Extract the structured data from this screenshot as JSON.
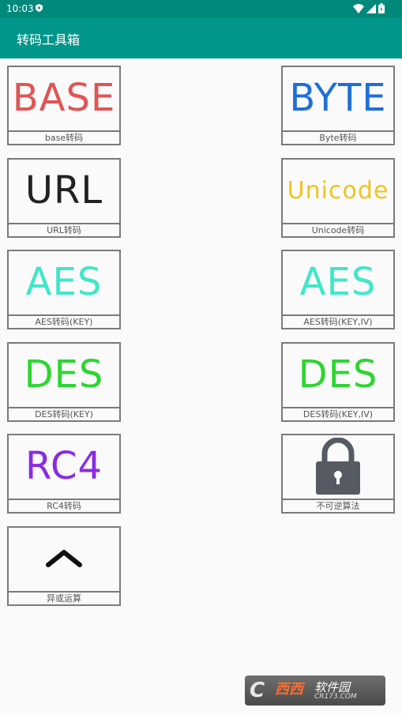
{
  "status": {
    "time": "10:03"
  },
  "app": {
    "title": "转码工具箱"
  },
  "tiles": [
    {
      "art": "BASE",
      "caption": "base转码",
      "color": "#e05555"
    },
    {
      "art": "BYTE",
      "caption": "Byte转码",
      "color": "#1e6fd9"
    },
    {
      "art": "URL",
      "caption": "URL转码",
      "color": "#222222"
    },
    {
      "art": "Unicode",
      "caption": "Unicode转码",
      "color": "#f2c41d"
    },
    {
      "art": "AES",
      "caption": "AES转码(KEY)",
      "color": "#3ee8c8"
    },
    {
      "art": "AES",
      "caption": "AES转码(KEY,IV)",
      "color": "#3ee8c8"
    },
    {
      "art": "DES",
      "caption": "DES转码(KEY)",
      "color": "#2bd630"
    },
    {
      "art": "DES",
      "caption": "DES转码(KEY,IV)",
      "color": "#2bd630"
    },
    {
      "art": "RC4",
      "caption": "RC4转码",
      "color": "#8a2be2"
    },
    {
      "art": "lock-icon",
      "caption": "不可逆算法",
      "color": "#555a63"
    },
    {
      "art": "caret-icon",
      "caption": "异或运算",
      "color": "#111111"
    }
  ],
  "watermark": {
    "brand": "西西",
    "site": "软件园",
    "url": "CR173.COM"
  }
}
